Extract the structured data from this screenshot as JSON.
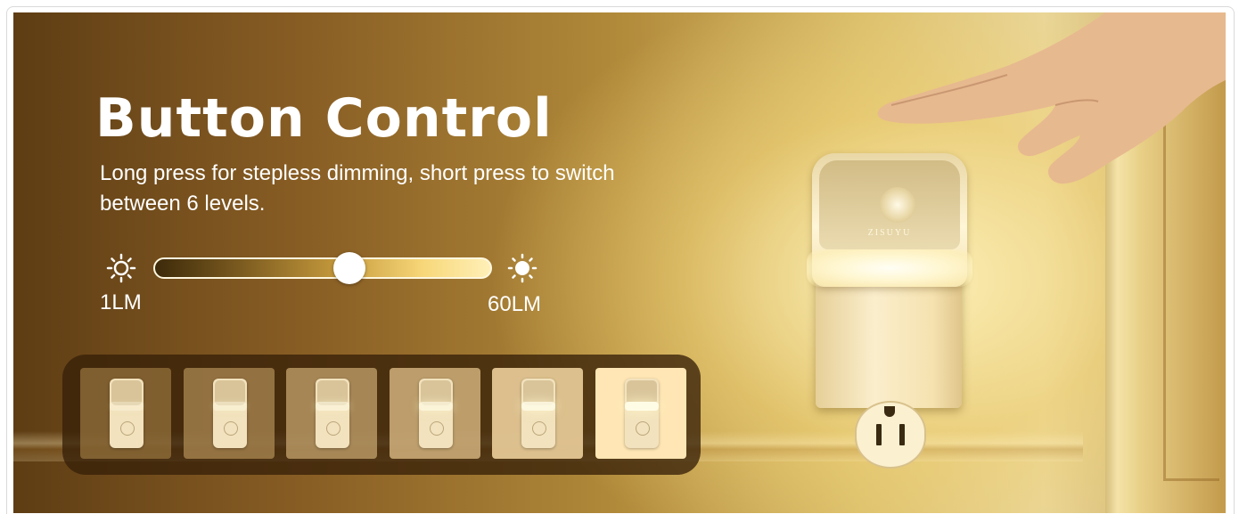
{
  "headline": {
    "title": "Button Control",
    "subtitle": "Long press for stepless dimming, short press to switch between 6 levels."
  },
  "brightness_slider": {
    "min_label": "1LM",
    "max_label": "60LM",
    "level": 0.58,
    "min_icon": "dim-sun-icon",
    "max_icon": "bright-sun-icon"
  },
  "product": {
    "brand": "ZISUYU"
  },
  "levels": [
    {
      "level": 1,
      "brightness": 0.15
    },
    {
      "level": 2,
      "brightness": 0.3
    },
    {
      "level": 3,
      "brightness": 0.45
    },
    {
      "level": 4,
      "brightness": 0.6
    },
    {
      "level": 5,
      "brightness": 0.8
    },
    {
      "level": 6,
      "brightness": 1.0
    }
  ],
  "colors": {
    "text": "#ffffff",
    "accent_glow": "#fff4c4",
    "panel": "#3a2208"
  }
}
